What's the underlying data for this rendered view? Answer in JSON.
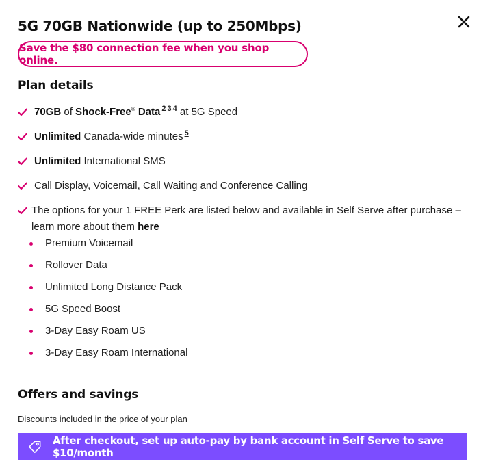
{
  "modal": {
    "title": "5G 70GB Nationwide (up to 250Mbps)",
    "close_icon": "close-icon"
  },
  "promo": {
    "text": "Save the $80 connection fee when you shop online."
  },
  "plan_details": {
    "heading": "Plan details",
    "features": [
      {
        "bold_amount": "70GB",
        "of": " of ",
        "bold_brand": "Shock-Free",
        "reg": "®",
        "bold_data": " Data",
        "sup_refs": [
          "2",
          "3",
          "4"
        ],
        "rest": " at 5G Speed"
      },
      {
        "bold": "Unlimited",
        "rest": " Canada-wide minutes",
        "sup": "5"
      },
      {
        "bold": "Unlimited",
        "rest": " International SMS"
      },
      {
        "rest": "Call Display, Voicemail, Call Waiting and Conference Calling"
      },
      {
        "rest": "The options for your 1 FREE Perk are listed below and available in Self Serve after purchase – learn more about them ",
        "link": "here"
      }
    ],
    "perks": [
      "Premium Voicemail",
      "Rollover Data",
      "Unlimited Long Distance Pack",
      "5G Speed Boost",
      "3-Day Easy Roam US",
      "3-Day Easy Roam International"
    ]
  },
  "offers": {
    "heading": "Offers and savings",
    "discount_label": "Discounts included in the price of your plan",
    "banner_icon": "tag-icon",
    "banner_text": "After checkout, set up auto-pay by bank account in Self Serve to save $10/month"
  },
  "colors": {
    "accent_magenta": "#d8006f",
    "banner_purple": "#7c4dff",
    "text": "#111111"
  }
}
